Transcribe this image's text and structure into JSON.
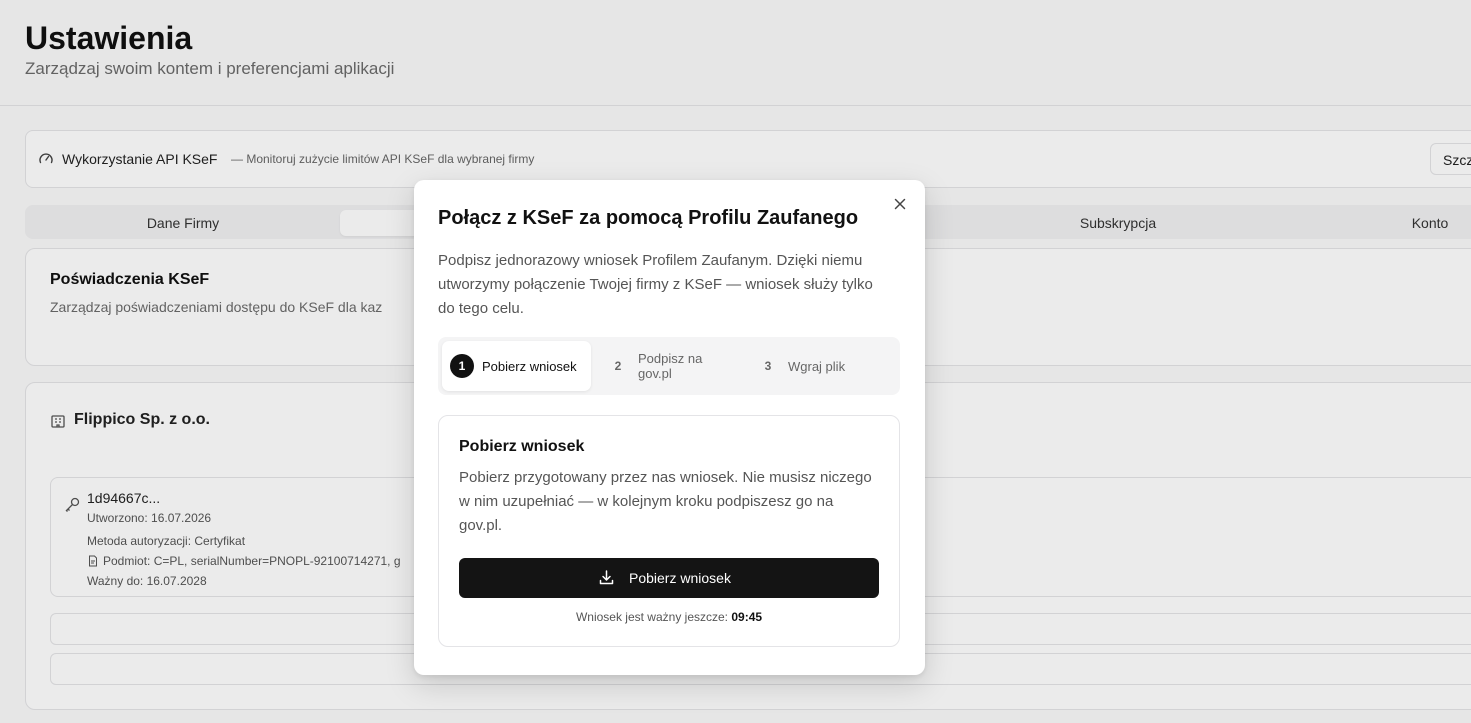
{
  "page": {
    "title": "Ustawienia",
    "subtitle": "Zarządzaj swoim kontem i preferencjami aplikacji"
  },
  "api_usage": {
    "title": "Wykorzystanie API KSeF",
    "description": "— Monitoruj zużycie limitów API KSeF dla wybranej firmy",
    "button_label": "Szcz"
  },
  "tabs": [
    {
      "label": "Dane Firmy"
    },
    {
      "label": ""
    },
    {
      "label": "Subskrypcja"
    },
    {
      "label": "Konto"
    }
  ],
  "credentials": {
    "title": "Poświadczenia KSeF",
    "description": "Zarządzaj poświadczeniami dostępu do KSeF dla kaz"
  },
  "company": {
    "name": "Flippico Sp. z o.o.",
    "certificate": {
      "id": "1d94667c...",
      "created": "Utworzono: 16.07.2026",
      "method": "Metoda autoryzacji:  Certyfikat",
      "subject": "Podmiot: C=PL, serialNumber=PNOPL-92100714271, g",
      "valid_until": "Ważny do: 16.07.2028"
    }
  },
  "modal": {
    "title": "Połącz z KSeF za pomocą Profilu Zaufanego",
    "description": "Podpisz jednorazowy wniosek Profilem Zaufanym. Dzięki niemu utworzymy połączenie Twojej firmy z KSeF — wniosek służy tylko do tego celu.",
    "steps": [
      {
        "number": "1",
        "label": "Pobierz wniosek",
        "active": true
      },
      {
        "number": "2",
        "label_line1": "Podpisz na",
        "label_line2": "gov.pl",
        "active": false
      },
      {
        "number": "3",
        "label": "Wgraj plik",
        "active": false
      }
    ],
    "step_panel": {
      "title": "Pobierz wniosek",
      "description": "Pobierz przygotowany przez nas wniosek. Nie musisz niczego w nim uzupełniać — w kolejnym kroku podpiszesz go na gov.pl.",
      "button_label": "Pobierz wniosek",
      "validity_prefix": "Wniosek jest ważny jeszcze: ",
      "validity_time": "09:45"
    }
  }
}
